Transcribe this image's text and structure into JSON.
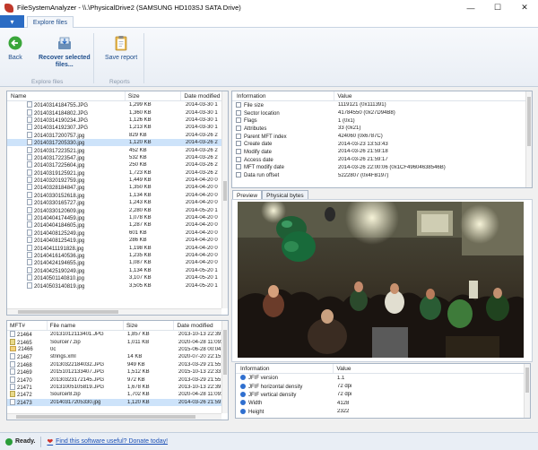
{
  "window": {
    "title": "FileSystemAnalyzer - \\\\.\\PhysicalDrive2 (SAMSUNG HD103SJ SATA Drive)",
    "minimize": "—",
    "maximize": "☐",
    "close": "✕"
  },
  "ribbon": {
    "file_menu": "▾",
    "tab": "Explore files",
    "back_label": "Back",
    "recover_label_1": "Recover selected",
    "recover_label_2": "files...",
    "save_report_label": "Save report",
    "group_explore": "Explore files",
    "group_reports": "Reports"
  },
  "files_list": {
    "columns": [
      "Name",
      "Size",
      "Date modified"
    ],
    "rows": [
      {
        "name": "20140314184755.JPG",
        "size": "1,299 KB",
        "date": "2014-03-30 1"
      },
      {
        "name": "20140314184802.JPG",
        "size": "1,360 KB",
        "date": "2014-03-30 1"
      },
      {
        "name": "20140314190234.JPG",
        "size": "1,126 KB",
        "date": "2014-03-30 1"
      },
      {
        "name": "20140314192307.JPG",
        "size": "1,213 KB",
        "date": "2014-03-30 1"
      },
      {
        "name": "20140317200757.jpg",
        "size": "829 KB",
        "date": "2014-03-26 2"
      },
      {
        "name": "20140317205330.jpg",
        "size": "1,120 KB",
        "date": "2014-03-26 2"
      },
      {
        "name": "20140317223521.jpg",
        "size": "452 KB",
        "date": "2014-03-26 2"
      },
      {
        "name": "20140317223547.jpg",
        "size": "532 KB",
        "date": "2014-03-26 2"
      },
      {
        "name": "20140317225604.jpg",
        "size": "250 KB",
        "date": "2014-03-26 2"
      },
      {
        "name": "20140319125921.jpg",
        "size": "1,723 KB",
        "date": "2014-03-26 2"
      },
      {
        "name": "20140320192759.jpg",
        "size": "1,449 KB",
        "date": "2014-04-20 0"
      },
      {
        "name": "20140328184847.jpg",
        "size": "1,350 KB",
        "date": "2014-04-20 0"
      },
      {
        "name": "20140330152618.jpg",
        "size": "1,134 KB",
        "date": "2014-04-20 0"
      },
      {
        "name": "20140330165727.jpg",
        "size": "1,243 KB",
        "date": "2014-04-20 0"
      },
      {
        "name": "20140330120609.jpg",
        "size": "2,280 KB",
        "date": "2014-05-20 1"
      },
      {
        "name": "20140404174459.jpg",
        "size": "1,078 KB",
        "date": "2014-04-20 0"
      },
      {
        "name": "20140404184605.jpg",
        "size": "1,287 KB",
        "date": "2014-04-20 0"
      },
      {
        "name": "20140408125249.jpg",
        "size": "601 KB",
        "date": "2014-04-20 0"
      },
      {
        "name": "20140408125419.jpg",
        "size": "286 KB",
        "date": "2014-04-20 0"
      },
      {
        "name": "20140411191828.jpg",
        "size": "1,198 KB",
        "date": "2014-04-20 0"
      },
      {
        "name": "20140416140536.jpg",
        "size": "1,235 KB",
        "date": "2014-04-20 0"
      },
      {
        "name": "20140424194655.jpg",
        "size": "1,087 KB",
        "date": "2014-04-20 0"
      },
      {
        "name": "20140425190249.jpg",
        "size": "1,134 KB",
        "date": "2014-05-20 1"
      },
      {
        "name": "20140501140810.jpg",
        "size": "3,107 KB",
        "date": "2014-05-20 1"
      },
      {
        "name": "20140503140819.jpg",
        "size": "3,505 KB",
        "date": "2014-05-20 1"
      }
    ]
  },
  "mft_list": {
    "columns": [
      "MFT#",
      "File name",
      "Size",
      "Date modified"
    ],
    "rows": [
      {
        "mft": "21464",
        "name": "20131012113401.JPG",
        "size": "1,857 KB",
        "date": "2013-10-13 22:39:",
        "type": "file"
      },
      {
        "mft": "21465",
        "name": "Sourcer7.zip",
        "size": "1,011 KB",
        "date": "2020-04-28 11:09:",
        "type": "zip"
      },
      {
        "mft": "21466",
        "name": "0c",
        "size": "",
        "date": "2015-06-28 00:04:",
        "type": "folder"
      },
      {
        "mft": "21467",
        "name": "strings.xml",
        "size": "14 KB",
        "date": "2020-07-20 22:15:",
        "type": "file"
      },
      {
        "mft": "21468",
        "name": "20130322184032.JPG",
        "size": "949 KB",
        "date": "2013-03-29 21:55:",
        "type": "file"
      },
      {
        "mft": "21469",
        "name": "20151012133407.JPG",
        "size": "1,512 KB",
        "date": "2015-10-13 22:33:",
        "type": "file"
      },
      {
        "mft": "21470",
        "name": "20130323172145.JPG",
        "size": "972 KB",
        "date": "2013-03-29 21:55:",
        "type": "file"
      },
      {
        "mft": "21471",
        "name": "20131005105819.JPG",
        "size": "1,678 KB",
        "date": "2013-10-13 22:39:",
        "type": "file"
      },
      {
        "mft": "21472",
        "name": "Sourcer8.zip",
        "size": "1,702 KB",
        "date": "2020-04-28 11:09:",
        "type": "zip"
      },
      {
        "mft": "21473",
        "name": "20140317205330.jpg",
        "size": "1,120 KB",
        "date": "2014-03-26 21:59:",
        "type": "file"
      }
    ]
  },
  "info_top": {
    "columns": [
      "Information",
      "Value"
    ],
    "rows": [
      {
        "label": "File size",
        "value": "1119121 (0x111391)"
      },
      {
        "label": "Sector location",
        "value": "41784550 (0x27D94B8)"
      },
      {
        "label": "Flags",
        "value": "1 (0x1)"
      },
      {
        "label": "Attributes",
        "value": "33 (0x21)"
      },
      {
        "label": "Parent MFT index",
        "value": "424060 (0x6787C)"
      },
      {
        "label": "Create date",
        "value": "2014-03-23 13:53:43"
      },
      {
        "label": "Modify date",
        "value": "2014-03-26 21:59:18"
      },
      {
        "label": "Access date",
        "value": "2014-03-26 21:59:17"
      },
      {
        "label": "MFT modify date",
        "value": "2014-03-26 22:00:06 (0x1CF49604638546B)"
      },
      {
        "label": "Data run offset",
        "value": "5222807 (0x4FB197)"
      }
    ]
  },
  "preview_tabs": {
    "preview": "Preview",
    "physical": "Physical bytes"
  },
  "info_bottom": {
    "columns": [
      "Information",
      "Value"
    ],
    "rows": [
      {
        "label": "JFIF version",
        "value": "1.1"
      },
      {
        "label": "JFIF horizontal density",
        "value": "72 dpi"
      },
      {
        "label": "JFIF vertical density",
        "value": "72 dpi"
      },
      {
        "label": "Width",
        "value": "4128"
      },
      {
        "label": "Height",
        "value": "2322"
      }
    ]
  },
  "status": {
    "ready": "Ready.",
    "donate": "Find this software useful? Donate today!"
  }
}
